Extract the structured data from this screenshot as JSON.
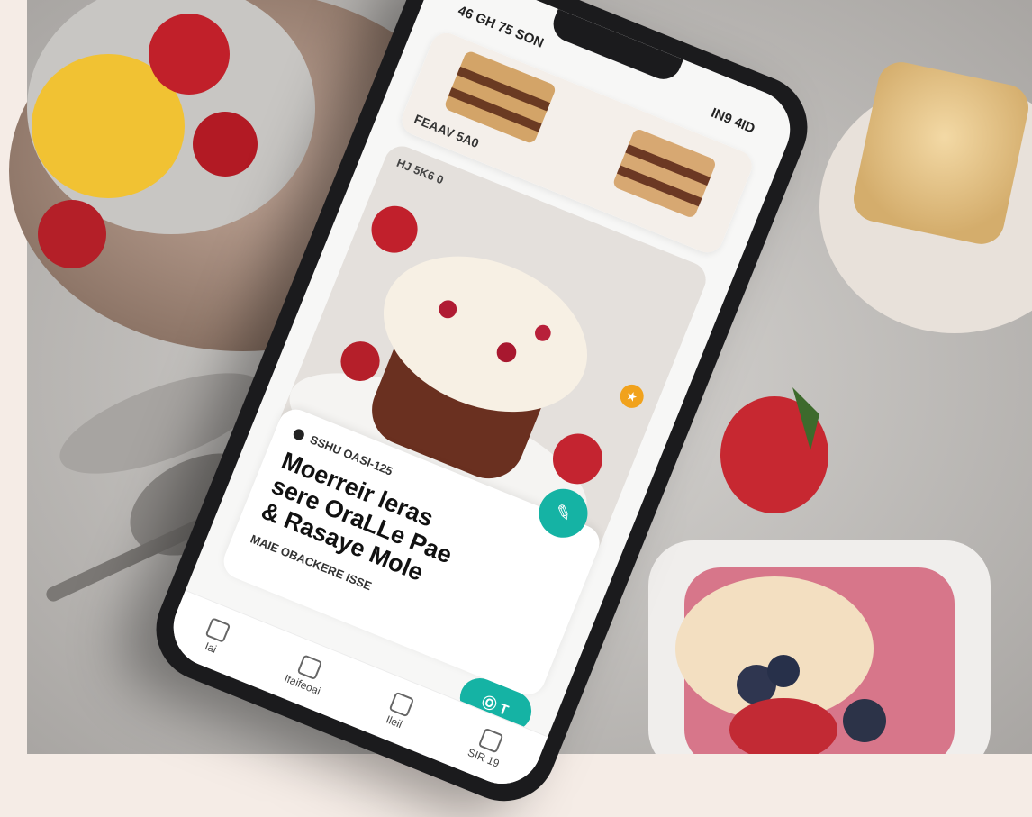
{
  "status_bar": {
    "time": "46 GH 75 SON",
    "right": "IN9 4ID"
  },
  "top_card": {
    "label": "FEAAV 5A0"
  },
  "hero": {
    "tag": "HJ 5K6 0"
  },
  "content": {
    "badge": "SSHU OASI-125",
    "title_lines": [
      "Moerreir leras",
      "sere OraLLe Pae",
      "& Rasaye Mole"
    ],
    "subtitle": "MAIE OBACKERE ISSE"
  },
  "buttons": {
    "fab": "✎",
    "cta": "Ⓞ T"
  },
  "tabbar": {
    "items": [
      "Iai",
      "Ifaifeoai",
      "Ileii",
      "SIR 19"
    ]
  },
  "colors": {
    "accent": "#15b3a4",
    "favorite": "#f1a21c"
  }
}
